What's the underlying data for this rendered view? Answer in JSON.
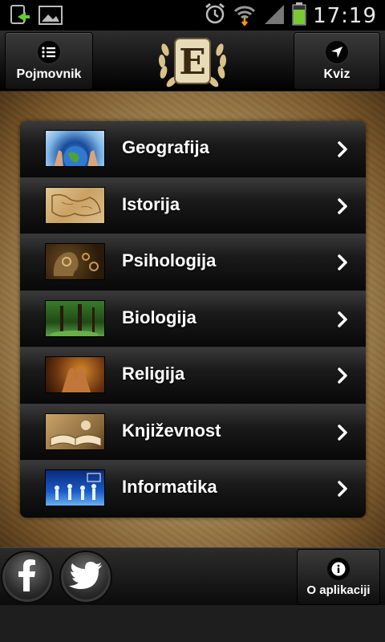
{
  "statusbar": {
    "time": "17:19"
  },
  "header": {
    "left_button": {
      "label": "Pojmovnik",
      "icon": "list-icon"
    },
    "logo": {
      "letter": "E"
    },
    "right_button": {
      "label": "Kviz",
      "icon": "navigation-arrow-icon"
    }
  },
  "menu": {
    "items": [
      {
        "label": "Geografija",
        "thumb": "globe-hands"
      },
      {
        "label": "Istorija",
        "thumb": "old-map"
      },
      {
        "label": "Psihologija",
        "thumb": "head-gears"
      },
      {
        "label": "Biologija",
        "thumb": "forest"
      },
      {
        "label": "Religija",
        "thumb": "praying-hands"
      },
      {
        "label": "Književnost",
        "thumb": "open-book"
      },
      {
        "label": "Informatika",
        "thumb": "digital-people"
      }
    ]
  },
  "footer": {
    "facebook_icon": "facebook-icon",
    "twitter_icon": "twitter-icon",
    "about_button": {
      "label": "O aplikaciji",
      "icon": "info-icon"
    }
  }
}
